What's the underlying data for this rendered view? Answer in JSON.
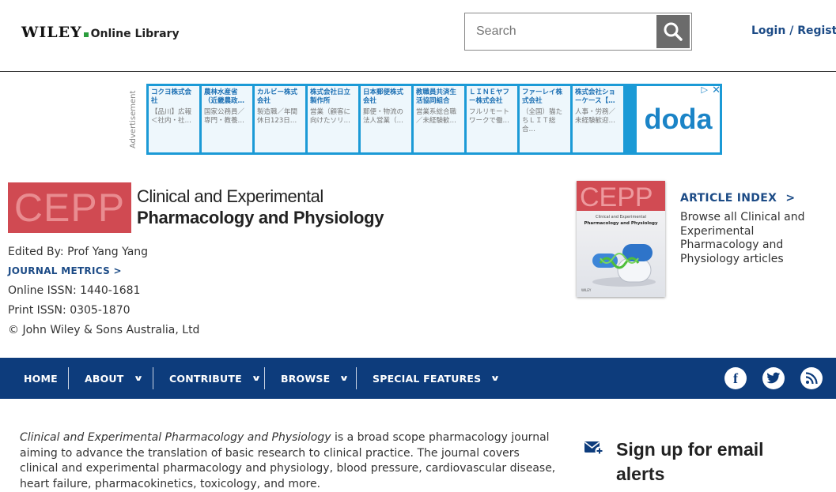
{
  "header": {
    "logo_brand": "WILEY",
    "logo_product": "Online Library",
    "search_placeholder": "Search",
    "login": "Login / Register"
  },
  "advertisement": {
    "label": "Advertisement",
    "brand": "doda",
    "cells": [
      {
        "title": "コクヨ株式会社",
        "sub": "【品川】広報＜社内・社…"
      },
      {
        "title": "農林水産省（近畿農政…",
        "sub": "国家公務員／専門・教養…"
      },
      {
        "title": "カルビー株式会社",
        "sub": "製造職／年間休日123日…"
      },
      {
        "title": "株式会社日立製作所",
        "sub": "営業（顧客に向けたソリ…"
      },
      {
        "title": "日本郵便株式会社",
        "sub": "郵便・物流の法人営業（…"
      },
      {
        "title": "教職員共済生活協同組合",
        "sub": "営業系総合職／未経験歓…"
      },
      {
        "title": "ＬＩＮＥヤフー株式会社",
        "sub": "フルリモートワークで働…"
      },
      {
        "title": "ファーレイ株式会社",
        "sub": "（全国）猫たちＬＩＴ総合…"
      },
      {
        "title": "株式会社ショーケース【…",
        "sub": "人事・労務／未経験歓迎…"
      }
    ]
  },
  "journal": {
    "logo_abbrev": "CEPP",
    "title_line1": "Clinical and Experimental",
    "title_line2": "Pharmacology and Physiology",
    "edited_by": "Edited By: Prof Yang Yang",
    "metrics_link": "JOURNAL METRICS >",
    "online_issn": "Online ISSN: 1440-1681",
    "print_issn": "Print ISSN: 0305-1870",
    "copyright": "© John Wiley & Sons Australia, Ltd",
    "cover_abbrev": "CEPP",
    "cover_subtitle1": "Clinical and Experimental",
    "cover_subtitle2": "Pharmacology and Physiology",
    "cover_footer": "WILEY"
  },
  "article_index": {
    "label": "ARTICLE INDEX",
    "arrow": ">",
    "description": "Browse all Clinical and Experimental Pharmacology and Physiology articles"
  },
  "nav": {
    "items": [
      "HOME",
      "ABOUT",
      "CONTRIBUTE",
      "BROWSE",
      "SPECIAL FEATURES"
    ],
    "chevron": "∨"
  },
  "social": {
    "facebook": "f",
    "twitter": "t",
    "rss": "r"
  },
  "about": {
    "journal_name": "Clinical and Experimental Pharmacology and Physiology",
    "text": " is a broad scope pharmacology journal aiming to advance the translation of basic research to clinical practice. The journal covers clinical and experimental pharmacology and physiology, blood pressure, cardiovascular disease, heart failure, pharmacokinetics, toxicology, and more."
  },
  "signup": {
    "title": "Sign up for email alerts"
  },
  "colors": {
    "nav_bg": "#0d3c7c",
    "link": "#1c4b86",
    "journal_red": "#d04a52",
    "ad_blue": "#1b9ad6"
  }
}
